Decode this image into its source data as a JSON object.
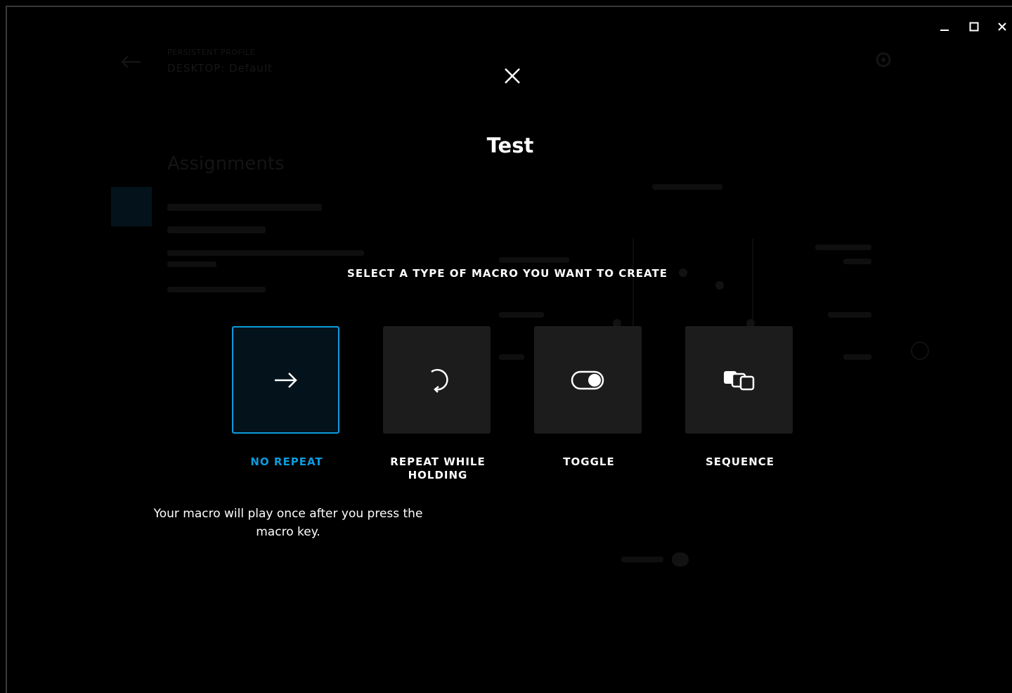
{
  "window": {
    "controls": [
      "minimize-icon",
      "maximize-icon",
      "close-icon"
    ]
  },
  "background": {
    "profile_label": "PERSISTENT PROFILE",
    "profile_name": "DESKTOP: Default",
    "section_title": "Assignments"
  },
  "modal": {
    "title": "Test",
    "subtitle": "SELECT A TYPE OF MACRO YOU WANT TO CREATE",
    "options": [
      {
        "label": "NO REPEAT",
        "icon": "arrow-right-icon",
        "selected": true
      },
      {
        "label": "REPEAT WHILE HOLDING",
        "icon": "repeat-icon",
        "selected": false
      },
      {
        "label": "TOGGLE",
        "icon": "toggle-icon",
        "selected": false
      },
      {
        "label": "SEQUENCE",
        "icon": "sequence-icon",
        "selected": false
      }
    ],
    "description": "Your macro will play once after you press the macro key."
  },
  "colors": {
    "accent": "#0d9bde",
    "tile": "#1c1c1c",
    "selected_tile_bg": "#04121b",
    "background": "#000000"
  }
}
